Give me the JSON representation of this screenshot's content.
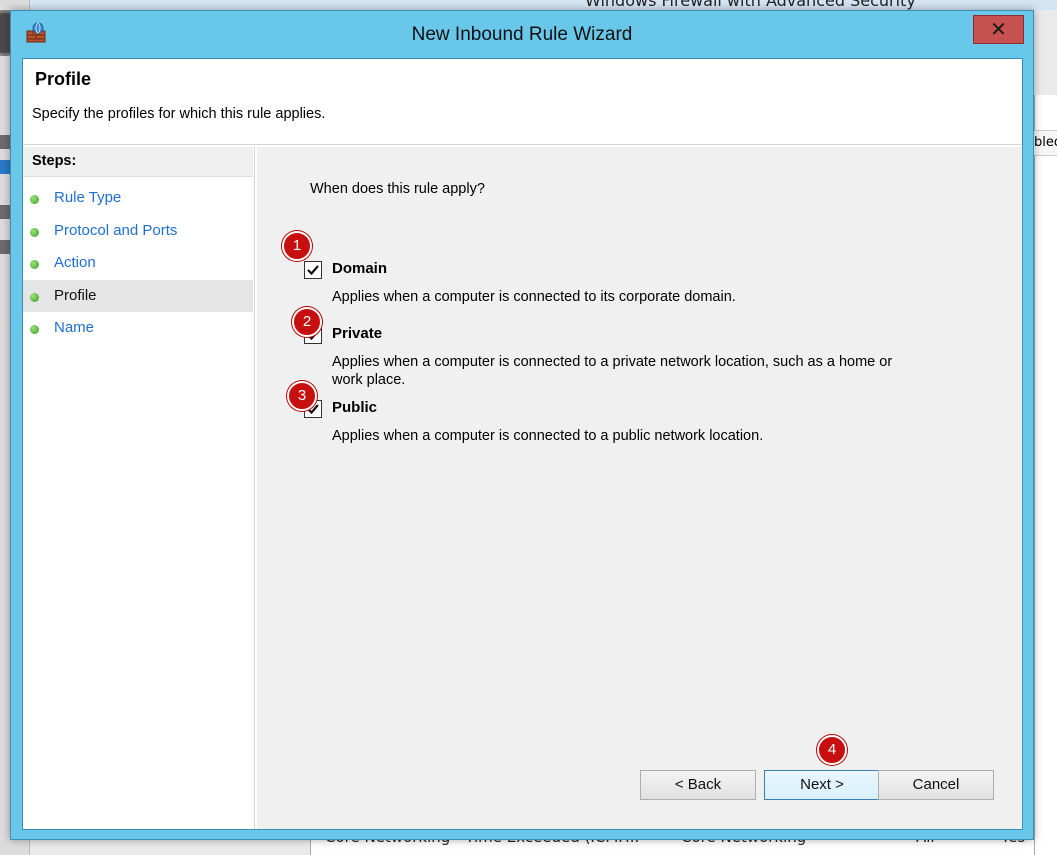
{
  "background": {
    "window_title": "Windows Firewall with Advanced Security",
    "right_header_text": "bled",
    "bottom_row": [
      "Core Networking - Time Exceeded (ICMP...",
      "Core Networking",
      "All",
      "Yes"
    ]
  },
  "dialog": {
    "title": "New Inbound Rule Wizard",
    "close_glyph": "✕"
  },
  "header": {
    "title": "Profile",
    "subtitle": "Specify the profiles for which this rule applies."
  },
  "steps": {
    "heading": "Steps:",
    "items": [
      {
        "label": "Rule Type"
      },
      {
        "label": "Protocol and Ports"
      },
      {
        "label": "Action"
      },
      {
        "label": "Profile"
      },
      {
        "label": "Name"
      }
    ],
    "current": "Profile"
  },
  "main": {
    "question": "When does this rule apply?",
    "options": [
      {
        "label": "Domain",
        "checked": true,
        "description": "Applies when a computer is connected to its corporate domain."
      },
      {
        "label": "Private",
        "checked": true,
        "description": "Applies when a computer is connected to a private network location, such as a home or work place."
      },
      {
        "label": "Public",
        "checked": true,
        "description": "Applies when a computer is connected to a public network location."
      }
    ]
  },
  "buttons": {
    "back": "< Back",
    "next": "Next >",
    "cancel": "Cancel"
  },
  "badges": [
    "1",
    "2",
    "3",
    "4"
  ],
  "colors": {
    "title_bar": "#69c7ea",
    "close_button": "#c75050",
    "badge": "#c80f0f",
    "step_link": "#1f6fd0"
  }
}
